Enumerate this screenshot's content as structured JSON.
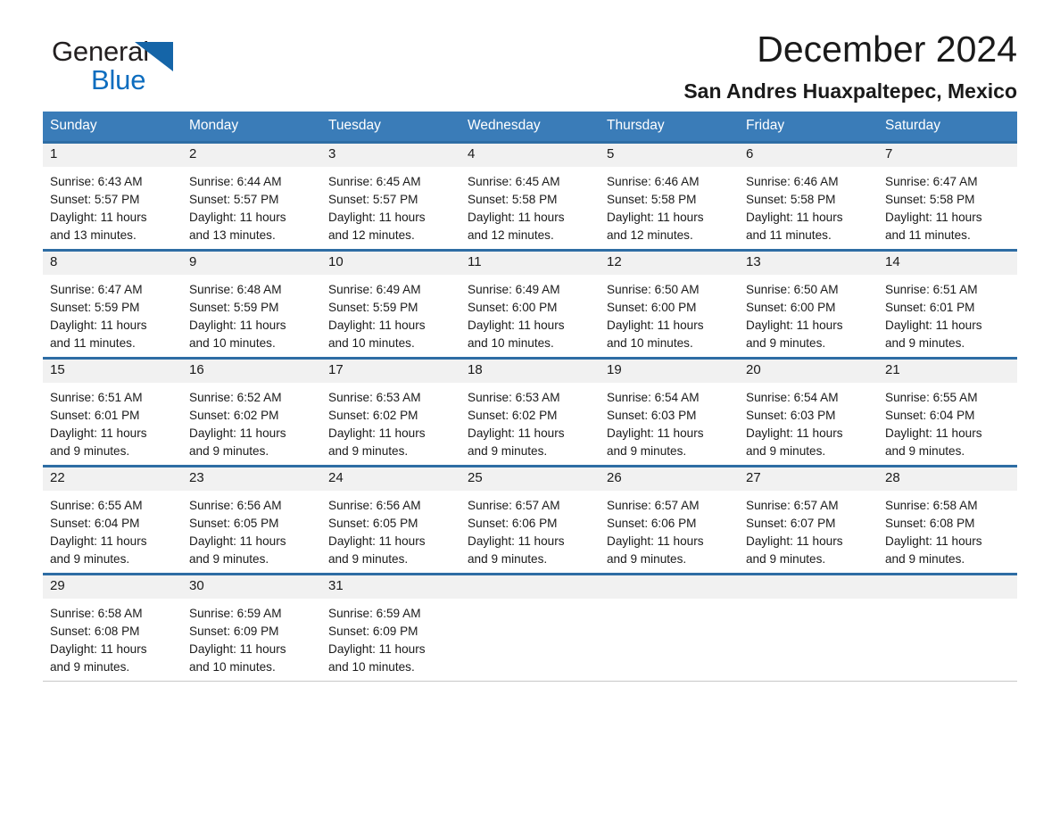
{
  "brand": {
    "name_part1": "General",
    "name_part2": "Blue",
    "triangle_color": "#1565a8",
    "blue_color": "#0d6dbf"
  },
  "header": {
    "title": "December 2024",
    "subtitle": "San Andres Huaxpaltepec, Mexico",
    "header_row_color": "#3a7cb8",
    "row_divider_color": "#2e6da4"
  },
  "weekday_headers": [
    "Sunday",
    "Monday",
    "Tuesday",
    "Wednesday",
    "Thursday",
    "Friday",
    "Saturday"
  ],
  "weeks": [
    [
      {
        "day": "1",
        "sunrise": "Sunrise: 6:43 AM",
        "sunset": "Sunset: 5:57 PM",
        "daylight1": "Daylight: 11 hours",
        "daylight2": "and 13 minutes."
      },
      {
        "day": "2",
        "sunrise": "Sunrise: 6:44 AM",
        "sunset": "Sunset: 5:57 PM",
        "daylight1": "Daylight: 11 hours",
        "daylight2": "and 13 minutes."
      },
      {
        "day": "3",
        "sunrise": "Sunrise: 6:45 AM",
        "sunset": "Sunset: 5:57 PM",
        "daylight1": "Daylight: 11 hours",
        "daylight2": "and 12 minutes."
      },
      {
        "day": "4",
        "sunrise": "Sunrise: 6:45 AM",
        "sunset": "Sunset: 5:58 PM",
        "daylight1": "Daylight: 11 hours",
        "daylight2": "and 12 minutes."
      },
      {
        "day": "5",
        "sunrise": "Sunrise: 6:46 AM",
        "sunset": "Sunset: 5:58 PM",
        "daylight1": "Daylight: 11 hours",
        "daylight2": "and 12 minutes."
      },
      {
        "day": "6",
        "sunrise": "Sunrise: 6:46 AM",
        "sunset": "Sunset: 5:58 PM",
        "daylight1": "Daylight: 11 hours",
        "daylight2": "and 11 minutes."
      },
      {
        "day": "7",
        "sunrise": "Sunrise: 6:47 AM",
        "sunset": "Sunset: 5:58 PM",
        "daylight1": "Daylight: 11 hours",
        "daylight2": "and 11 minutes."
      }
    ],
    [
      {
        "day": "8",
        "sunrise": "Sunrise: 6:47 AM",
        "sunset": "Sunset: 5:59 PM",
        "daylight1": "Daylight: 11 hours",
        "daylight2": "and 11 minutes."
      },
      {
        "day": "9",
        "sunrise": "Sunrise: 6:48 AM",
        "sunset": "Sunset: 5:59 PM",
        "daylight1": "Daylight: 11 hours",
        "daylight2": "and 10 minutes."
      },
      {
        "day": "10",
        "sunrise": "Sunrise: 6:49 AM",
        "sunset": "Sunset: 5:59 PM",
        "daylight1": "Daylight: 11 hours",
        "daylight2": "and 10 minutes."
      },
      {
        "day": "11",
        "sunrise": "Sunrise: 6:49 AM",
        "sunset": "Sunset: 6:00 PM",
        "daylight1": "Daylight: 11 hours",
        "daylight2": "and 10 minutes."
      },
      {
        "day": "12",
        "sunrise": "Sunrise: 6:50 AM",
        "sunset": "Sunset: 6:00 PM",
        "daylight1": "Daylight: 11 hours",
        "daylight2": "and 10 minutes."
      },
      {
        "day": "13",
        "sunrise": "Sunrise: 6:50 AM",
        "sunset": "Sunset: 6:00 PM",
        "daylight1": "Daylight: 11 hours",
        "daylight2": "and 9 minutes."
      },
      {
        "day": "14",
        "sunrise": "Sunrise: 6:51 AM",
        "sunset": "Sunset: 6:01 PM",
        "daylight1": "Daylight: 11 hours",
        "daylight2": "and 9 minutes."
      }
    ],
    [
      {
        "day": "15",
        "sunrise": "Sunrise: 6:51 AM",
        "sunset": "Sunset: 6:01 PM",
        "daylight1": "Daylight: 11 hours",
        "daylight2": "and 9 minutes."
      },
      {
        "day": "16",
        "sunrise": "Sunrise: 6:52 AM",
        "sunset": "Sunset: 6:02 PM",
        "daylight1": "Daylight: 11 hours",
        "daylight2": "and 9 minutes."
      },
      {
        "day": "17",
        "sunrise": "Sunrise: 6:53 AM",
        "sunset": "Sunset: 6:02 PM",
        "daylight1": "Daylight: 11 hours",
        "daylight2": "and 9 minutes."
      },
      {
        "day": "18",
        "sunrise": "Sunrise: 6:53 AM",
        "sunset": "Sunset: 6:02 PM",
        "daylight1": "Daylight: 11 hours",
        "daylight2": "and 9 minutes."
      },
      {
        "day": "19",
        "sunrise": "Sunrise: 6:54 AM",
        "sunset": "Sunset: 6:03 PM",
        "daylight1": "Daylight: 11 hours",
        "daylight2": "and 9 minutes."
      },
      {
        "day": "20",
        "sunrise": "Sunrise: 6:54 AM",
        "sunset": "Sunset: 6:03 PM",
        "daylight1": "Daylight: 11 hours",
        "daylight2": "and 9 minutes."
      },
      {
        "day": "21",
        "sunrise": "Sunrise: 6:55 AM",
        "sunset": "Sunset: 6:04 PM",
        "daylight1": "Daylight: 11 hours",
        "daylight2": "and 9 minutes."
      }
    ],
    [
      {
        "day": "22",
        "sunrise": "Sunrise: 6:55 AM",
        "sunset": "Sunset: 6:04 PM",
        "daylight1": "Daylight: 11 hours",
        "daylight2": "and 9 minutes."
      },
      {
        "day": "23",
        "sunrise": "Sunrise: 6:56 AM",
        "sunset": "Sunset: 6:05 PM",
        "daylight1": "Daylight: 11 hours",
        "daylight2": "and 9 minutes."
      },
      {
        "day": "24",
        "sunrise": "Sunrise: 6:56 AM",
        "sunset": "Sunset: 6:05 PM",
        "daylight1": "Daylight: 11 hours",
        "daylight2": "and 9 minutes."
      },
      {
        "day": "25",
        "sunrise": "Sunrise: 6:57 AM",
        "sunset": "Sunset: 6:06 PM",
        "daylight1": "Daylight: 11 hours",
        "daylight2": "and 9 minutes."
      },
      {
        "day": "26",
        "sunrise": "Sunrise: 6:57 AM",
        "sunset": "Sunset: 6:06 PM",
        "daylight1": "Daylight: 11 hours",
        "daylight2": "and 9 minutes."
      },
      {
        "day": "27",
        "sunrise": "Sunrise: 6:57 AM",
        "sunset": "Sunset: 6:07 PM",
        "daylight1": "Daylight: 11 hours",
        "daylight2": "and 9 minutes."
      },
      {
        "day": "28",
        "sunrise": "Sunrise: 6:58 AM",
        "sunset": "Sunset: 6:08 PM",
        "daylight1": "Daylight: 11 hours",
        "daylight2": "and 9 minutes."
      }
    ],
    [
      {
        "day": "29",
        "sunrise": "Sunrise: 6:58 AM",
        "sunset": "Sunset: 6:08 PM",
        "daylight1": "Daylight: 11 hours",
        "daylight2": "and 9 minutes."
      },
      {
        "day": "30",
        "sunrise": "Sunrise: 6:59 AM",
        "sunset": "Sunset: 6:09 PM",
        "daylight1": "Daylight: 11 hours",
        "daylight2": "and 10 minutes."
      },
      {
        "day": "31",
        "sunrise": "Sunrise: 6:59 AM",
        "sunset": "Sunset: 6:09 PM",
        "daylight1": "Daylight: 11 hours",
        "daylight2": "and 10 minutes."
      },
      {
        "day": "",
        "sunrise": "",
        "sunset": "",
        "daylight1": "",
        "daylight2": "",
        "empty": true
      },
      {
        "day": "",
        "sunrise": "",
        "sunset": "",
        "daylight1": "",
        "daylight2": "",
        "empty": true
      },
      {
        "day": "",
        "sunrise": "",
        "sunset": "",
        "daylight1": "",
        "daylight2": "",
        "empty": true
      },
      {
        "day": "",
        "sunrise": "",
        "sunset": "",
        "daylight1": "",
        "daylight2": "",
        "empty": true
      }
    ]
  ]
}
